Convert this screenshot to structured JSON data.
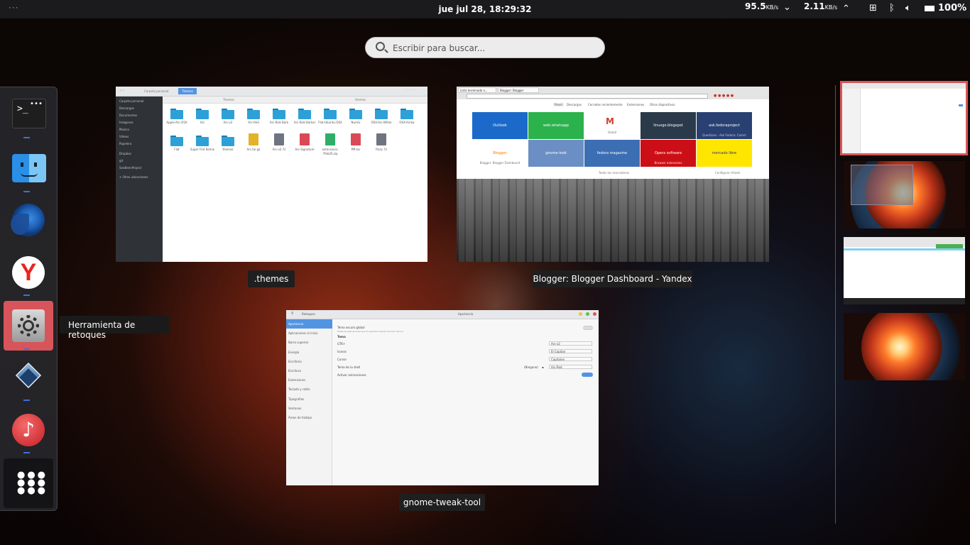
{
  "topbar": {
    "activities": "···",
    "clock": "jue jul 28, 18:29:32",
    "net_down": "95.5",
    "net_down_unit": "KB/s",
    "net_up": "2.11",
    "net_up_unit": "KB/s",
    "battery": "100%"
  },
  "search": {
    "placeholder": "Escribir para buscar..."
  },
  "dock": {
    "tooltip": "Herramienta de retoques",
    "items": [
      {
        "name": "terminal",
        "running": true
      },
      {
        "name": "finder",
        "running": true
      },
      {
        "name": "firefox",
        "running": false
      },
      {
        "name": "yandex",
        "running": true
      },
      {
        "name": "tweak-tool",
        "running": true,
        "selected": true
      },
      {
        "name": "virtualbox",
        "running": true
      },
      {
        "name": "music",
        "running": true
      },
      {
        "name": "app-grid",
        "running": false
      }
    ]
  },
  "windows": {
    "files": {
      "caption": ".themes",
      "sidebar": [
        "Carpeta personal",
        "Descargas",
        "Documentos",
        "Imágenes",
        "Música",
        "Vídeos",
        "Papelera",
        "Dropbox",
        "git",
        "SeeBeenProject",
        "+ Otras ubicaciones"
      ],
      "tabs": [
        "Themes",
        ".themes"
      ],
      "folders": [
        "Apple-Arc-OSX",
        "Arc",
        "Arc-v2",
        "Arc-Red",
        "Arc-Red-Dark",
        "Arc-Red-Darker",
        "Flat-Ubuntu-OSX",
        "Numix",
        "OSX-Arc-White",
        "OSX-Arrow",
        "Flat",
        "Super Flat Remix",
        "themes"
      ],
      "files": [
        "Arc.tar.gz",
        "Arc-v2.7z",
        "Arc-Signature",
        "extensions-7feb26.zip",
        "PM.tar",
        "fmac.7z"
      ]
    },
    "yandex": {
      "caption": "Blogger: Blogger Dashboard - Yandex",
      "tabs": [
        "Lista terminado v...",
        "Blogger: Blogger"
      ],
      "nav": [
        "Panel",
        "Descargas",
        "Cerrados recientemente",
        "Extensiones",
        "Otros dispositivos"
      ],
      "tiles": [
        "Outlook",
        "web.whatsapp",
        "Gmail",
        "linuxgo.blogspot",
        "ask.fedoraproject",
        "Blogger",
        "gnome-look",
        "fedora magazine",
        "Opera software",
        "mercado libre"
      ],
      "tile_sub": [
        "",
        "",
        "",
        "",
        "Questions - Ask Fedora: Comm",
        "Blogger: Blogger Dashboard",
        "",
        "",
        "Browser extensions",
        ""
      ],
      "footer_left": "Todos los marcadores",
      "footer_right": "Configurar  Añadir"
    },
    "tweak": {
      "caption": "gnome-tweak-tool",
      "title_left": "Retoques",
      "title_center": "Apariencia",
      "sidebar": [
        "Apariencia",
        "Aplicaciones al inicio",
        "Barra superior",
        "Energía",
        "Escritorio",
        "Escritura",
        "Extensiones",
        "Teclado y ratón",
        "Tipografías",
        "Ventanas",
        "Áreas de trabajo"
      ],
      "rows": [
        {
          "label": "Tema oscuro global",
          "value": ""
        },
        {
          "label": "Tema",
          "value": ""
        },
        {
          "label": "GTK+",
          "value": "Arc-v2"
        },
        {
          "label": "Iconos",
          "value": "El Capitan"
        },
        {
          "label": "Cursor",
          "value": "Capitaine"
        },
        {
          "label": "Tema de la shell",
          "value": "Arc-Red"
        },
        {
          "label": "Activar animaciones",
          "value": ""
        }
      ],
      "note": "Todas las aplicaciones que lo soporten usarán el modo oscuro",
      "shell_none": "(Ninguno)"
    }
  },
  "colors": {
    "accent_red": "#d7555a",
    "dock_running_dot": "#3c6fd8",
    "tweak_selected": "#5294e2"
  }
}
